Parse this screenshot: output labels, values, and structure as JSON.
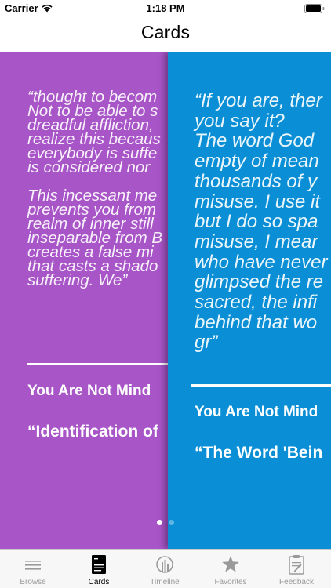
{
  "status_bar": {
    "carrier": "Carrier",
    "time": "1:18 PM"
  },
  "nav": {
    "title": "Cards"
  },
  "cards": [
    {
      "color": "#a855c8",
      "quote": "“thought to becom\nNot to be able to s\ndreadful affliction,\nrealize this becaus\neverybody is suffe\nis considered nor\n\nThis incessant me\nprevents you from\nrealm of inner still\ninseparable from B\ncreates a false mi\nthat casts a shado\nsuffering. We”",
      "chapter": "You Are Not Mind",
      "title": "“Identification of"
    },
    {
      "color": "#0a8fd6",
      "quote": "“If you are, ther\nyou say it?\nThe word God\nempty of mean\nthousands of y\nmisuse. I use it\nbut I do so spa\nmisuse, I mear\nwho have never\nglimpsed the re\nsacred, the infi\nbehind that wo\ngr”",
      "chapter": "You Are Not Mind",
      "title": "“The Word 'Bein"
    }
  ],
  "page_indicator": {
    "current": 1,
    "total": 2
  },
  "tabs": [
    {
      "label": "Browse",
      "icon": "list-icon",
      "active": false
    },
    {
      "label": "Cards",
      "icon": "cards-icon",
      "active": true
    },
    {
      "label": "Timeline",
      "icon": "timeline-icon",
      "active": false
    },
    {
      "label": "Favorites",
      "icon": "star-icon",
      "active": false
    },
    {
      "label": "Feedback",
      "icon": "clipboard-icon",
      "active": false
    }
  ],
  "colors": {
    "tab_active": "#000000",
    "tab_inactive": "#9a9a9a"
  }
}
